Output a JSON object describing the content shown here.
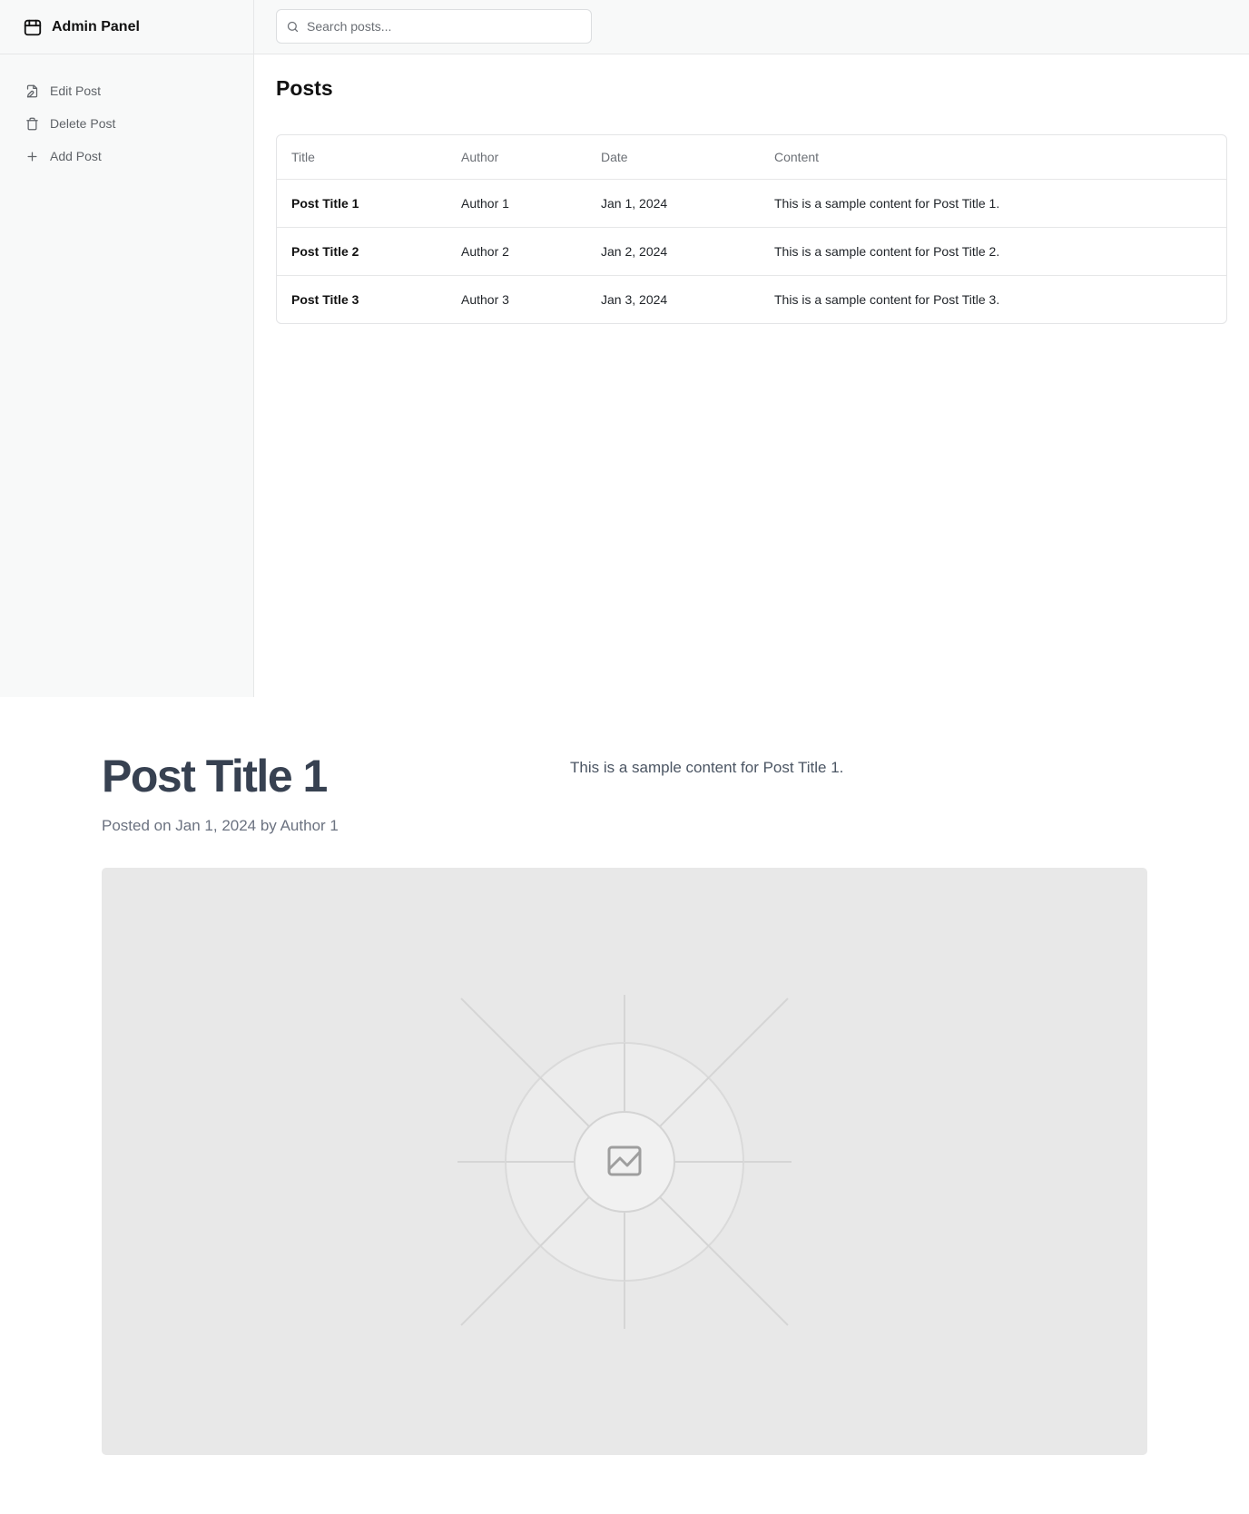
{
  "sidebar": {
    "brand_title": "Admin Panel",
    "brand_icon": "storefront-icon",
    "items": [
      {
        "label": "Edit Post",
        "icon": "file-edit-icon"
      },
      {
        "label": "Delete Post",
        "icon": "trash-icon"
      },
      {
        "label": "Add Post",
        "icon": "plus-icon"
      }
    ]
  },
  "header": {
    "search_placeholder": "Search posts...",
    "search_icon": "search-icon"
  },
  "main": {
    "title": "Posts",
    "table": {
      "columns": [
        "Title",
        "Author",
        "Date",
        "Content"
      ],
      "rows": [
        {
          "title": "Post Title 1",
          "author": "Author 1",
          "date": "Jan 1, 2024",
          "content": "This is a sample content for Post Title 1."
        },
        {
          "title": "Post Title 2",
          "author": "Author 2",
          "date": "Jan 2, 2024",
          "content": "This is a sample content for Post Title 2."
        },
        {
          "title": "Post Title 3",
          "author": "Author 3",
          "date": "Jan 3, 2024",
          "content": "This is a sample content for Post Title 3."
        }
      ]
    }
  },
  "post": {
    "title": "Post Title 1",
    "meta": "Posted on Jan 1, 2024 by Author 1",
    "content": "This is a sample content for Post Title 1.",
    "image_icon": "image-placeholder-icon"
  },
  "colors": {
    "sidebar_bg": "#f8f9f9",
    "border": "#e6e7e8",
    "post_title": "#374151",
    "image_bg": "#e8e8e8"
  }
}
